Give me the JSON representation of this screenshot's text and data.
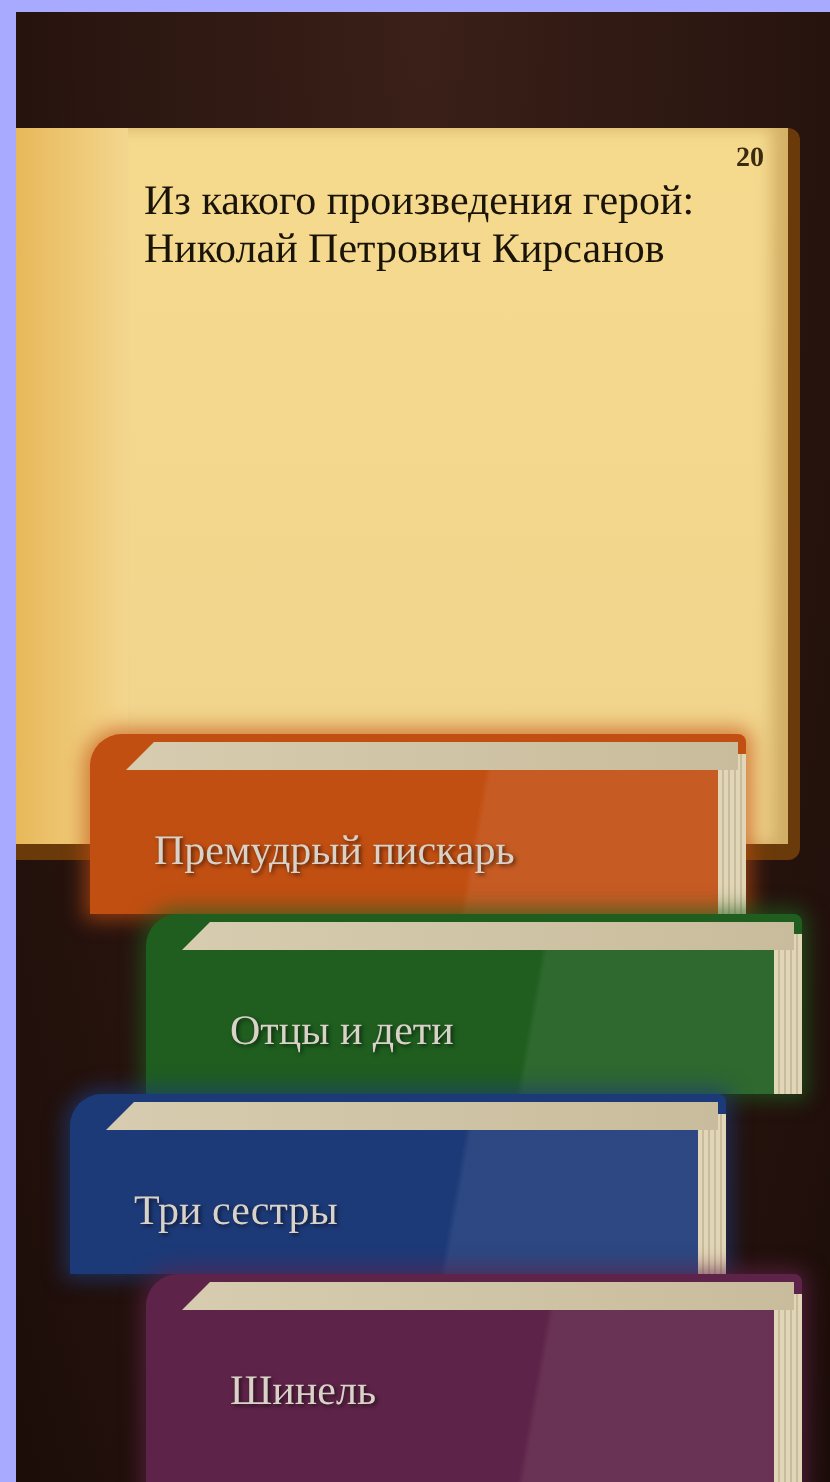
{
  "book": {
    "page_number": "20",
    "question": "Из какого произведения герой:",
    "hero": "Николай Петрович Кирсанов"
  },
  "answers": [
    {
      "title": "Премудрый пискарь",
      "color": "#c24f12"
    },
    {
      "title": "Отцы и дети",
      "color": "#1f5e1f"
    },
    {
      "title": "Три сестры",
      "color": "#1d3a78"
    },
    {
      "title": "Шинель",
      "color": "#5e2348"
    }
  ]
}
